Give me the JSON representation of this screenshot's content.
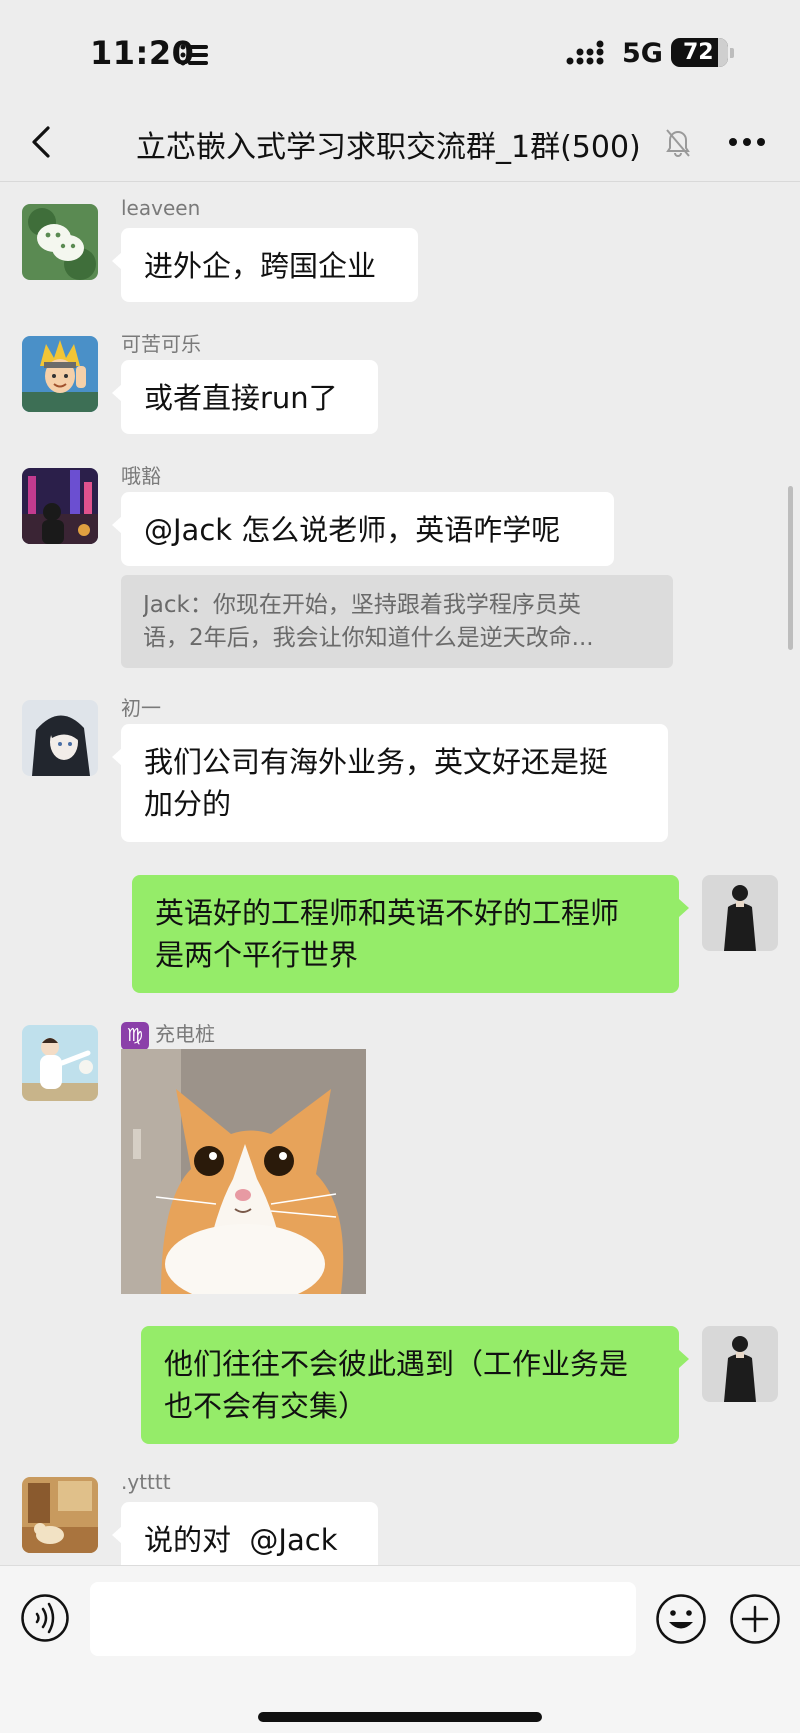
{
  "status_bar": {
    "time": "11:20",
    "network": "5G",
    "battery": "72",
    "battery_percent": 72
  },
  "nav": {
    "title": "立芯嵌入式学习求职交流群_1群(500)",
    "muted": true
  },
  "messages": [
    {
      "sender": "leaveen",
      "text": "进外企，跨国企业"
    },
    {
      "sender": "可苦可乐",
      "text": "或者直接run了"
    },
    {
      "sender": "哦豁",
      "text": "@Jack 怎么说老师，英语咋学呢",
      "quote": {
        "line1": "Jack：你现在开始，坚持跟着我学程序员英",
        "line2": "语，2年后，我会让你知道什么是逆天改命..."
      }
    },
    {
      "sender": "初一",
      "line1": "我们公司有海外业务，英文好还是挺",
      "line2": "加分的"
    },
    {
      "sender": "me",
      "line1": "英语好的工程师和英语不好的工程师",
      "line2": "是两个平行世界"
    },
    {
      "sender": "充电桩",
      "badge": "♍",
      "content": "cat-image"
    },
    {
      "sender": "me",
      "line1": "他们往往不会彼此遇到（工作业务是",
      "line2": "也不会有交集）"
    },
    {
      "sender": ".ytttt",
      "text": "说的对  @Jack"
    }
  ],
  "input": {
    "placeholder": ""
  },
  "icons": [
    "list-icon",
    "signal-icon",
    "back-icon",
    "mute-icon",
    "more-icon",
    "voice-icon",
    "emoji-icon",
    "plus-icon"
  ],
  "colors": {
    "background": "#ededed",
    "my_bubble": "#95ec69",
    "other_bubble": "#ffffff",
    "quote": "#dcdcdc"
  }
}
